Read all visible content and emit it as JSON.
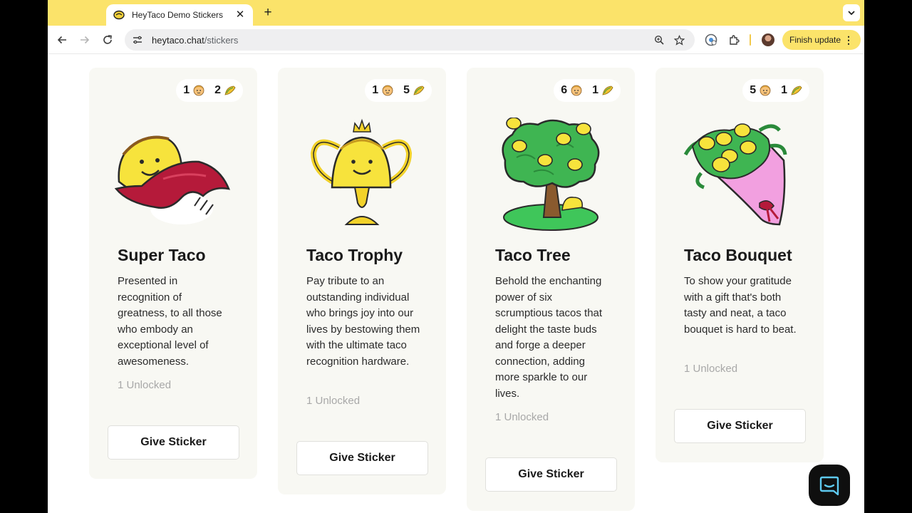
{
  "browser": {
    "tab_title": "HeyTaco Demo Stickers",
    "url_host": "heytaco.chat",
    "url_path": "/stickers",
    "finish_update_label": "Finish update",
    "accent_color": "#fbe36a"
  },
  "stickers": [
    {
      "stat_people": "1",
      "stat_tacos": "2",
      "title": "Super Taco",
      "description": "Presented in recognition of greatness, to all those who embody an exceptional level of awesomeness.",
      "unlocked": "1 Unlocked",
      "button_label": "Give Sticker",
      "icon": "super-taco-illustration"
    },
    {
      "stat_people": "1",
      "stat_tacos": "5",
      "title": "Taco Trophy",
      "description": "Pay tribute to an outstanding individual who brings joy into our lives by bestowing them with the ultimate taco recognition hardware.",
      "unlocked": "1 Unlocked",
      "button_label": "Give Sticker",
      "icon": "taco-trophy-illustration"
    },
    {
      "stat_people": "6",
      "stat_tacos": "1",
      "title": "Taco Tree",
      "description": "Behold the enchanting power of six scrumptious tacos that delight the taste buds and forge a deeper connection, adding more sparkle to our lives.",
      "unlocked": "1 Unlocked",
      "button_label": "Give Sticker",
      "icon": "taco-tree-illustration"
    },
    {
      "stat_people": "5",
      "stat_tacos": "1",
      "title": "Taco Bouquet",
      "description": "To show your gratitude with a gift that's both tasty and neat, a taco bouquet is hard to beat.",
      "unlocked": "1 Unlocked",
      "button_label": "Give Sticker",
      "icon": "taco-bouquet-illustration"
    }
  ]
}
